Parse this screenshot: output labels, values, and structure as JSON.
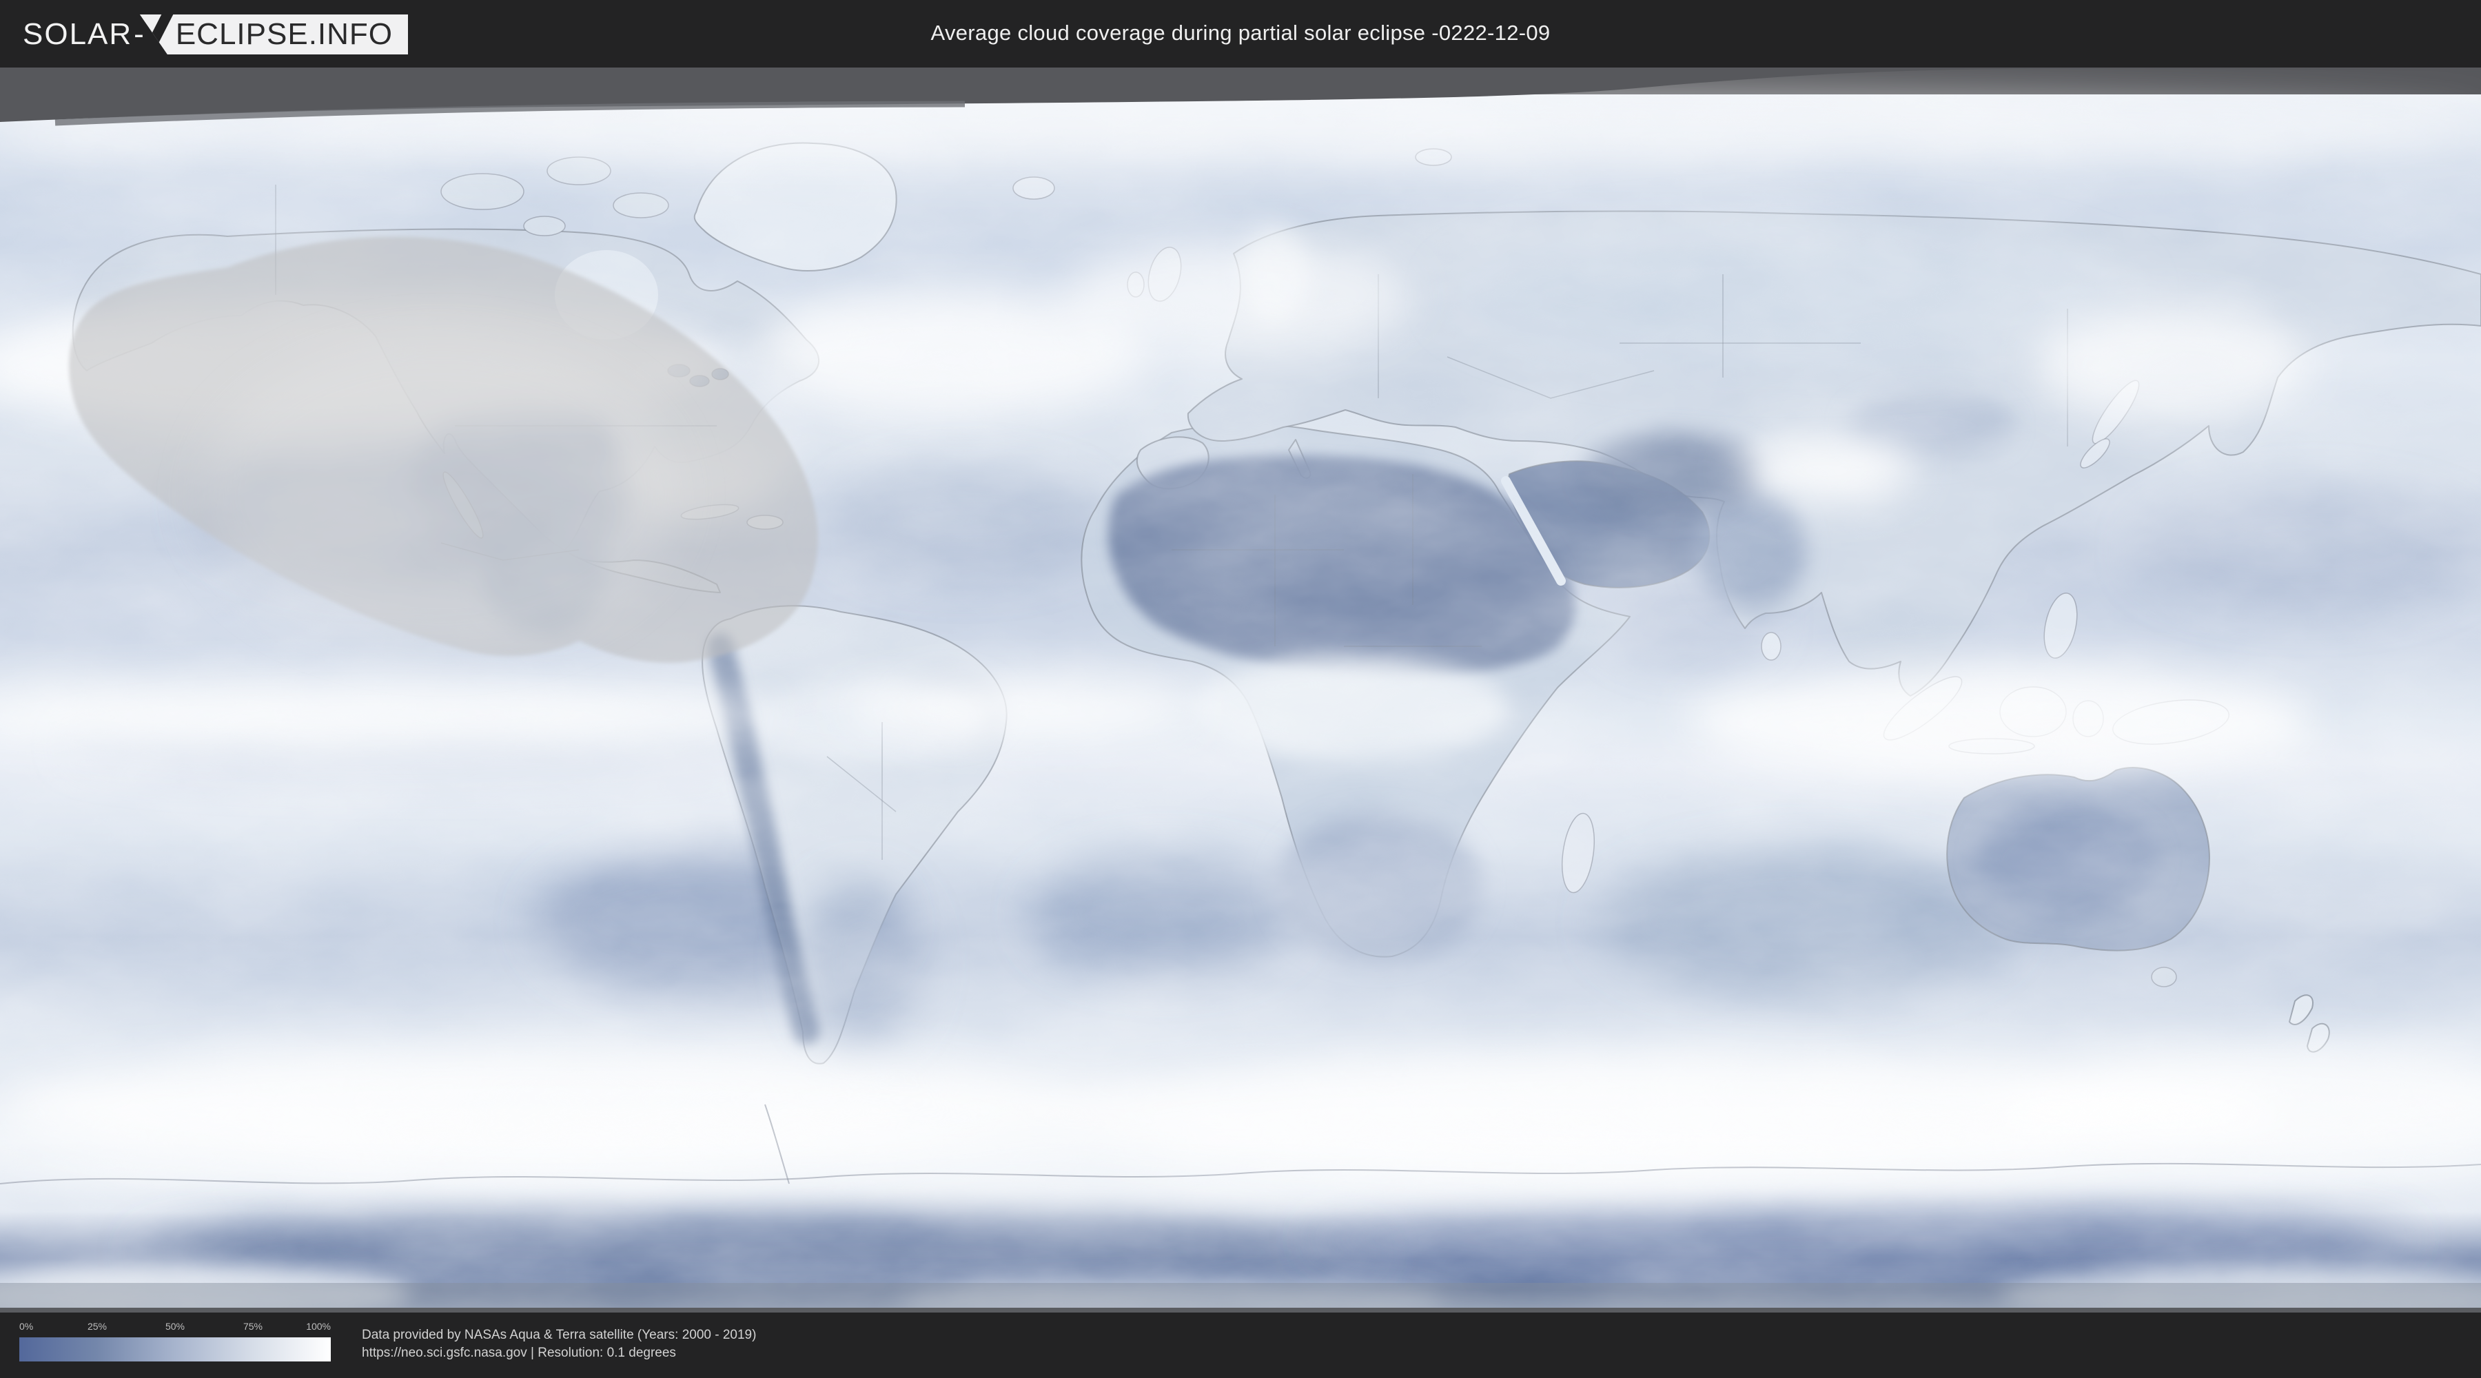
{
  "header": {
    "logo": {
      "part1": "SOLAR",
      "separator": "-",
      "part2": "ECLIPSE.INFO"
    },
    "title": "Average cloud coverage during partial solar eclipse -0222-12-09"
  },
  "map": {
    "description_visible_text": "",
    "eclipse_region": "shaded gray area over North America and northeast Pacific",
    "colors": {
      "ocean_light": "#d6dfeb",
      "cloud_white": "#f2f5f9",
      "clear_sky_blue": "#6d81a8",
      "no_data_gray": "#57585c",
      "eclipse_shadow": "#bdbdc0"
    }
  },
  "legend": {
    "ticks": [
      "0%",
      "25%",
      "50%",
      "75%",
      "100%"
    ],
    "gradient_start_color": "#53689b",
    "gradient_end_color": "#ffffff"
  },
  "footer": {
    "line1": "Data provided by NASAs Aqua & Terra satellite (Years: 2000 - 2019)",
    "line2": "https://neo.sci.gsfc.nasa.gov | Resolution: 0.1 degrees"
  },
  "colors": {
    "header_bg": "#232324",
    "map_band_gray": "#57585c"
  }
}
